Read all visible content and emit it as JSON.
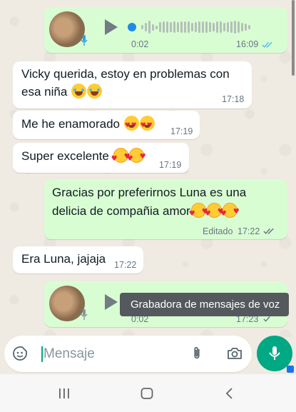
{
  "messages": [
    {
      "type": "voice",
      "direction": "out",
      "duration": "0:02",
      "time": "16:09",
      "status": "read"
    },
    {
      "type": "text",
      "direction": "in",
      "line1": "Vicky querida, estoy en problemas con",
      "line2": "esa niña",
      "emojis": [
        "rolling-laughing",
        "rolling-laughing"
      ],
      "time": "17:18"
    },
    {
      "type": "text",
      "direction": "in",
      "text": "Me he enamorado",
      "emojis": [
        "heart-eyes",
        "heart-eyes"
      ],
      "time": "17:19"
    },
    {
      "type": "text",
      "direction": "in",
      "text": "Super excelente",
      "emojis": [
        "smiling-hearts",
        "smiling-hearts"
      ],
      "time": "17:19"
    },
    {
      "type": "text",
      "direction": "out",
      "line1": "Gracias por preferirnos Luna es una",
      "line2": "delicia de compañia amor",
      "emojis": [
        "smiling-hearts",
        "smiling-hearts",
        "smiling-hearts"
      ],
      "edited_label": "Editado",
      "time": "17:22",
      "status": "read"
    },
    {
      "type": "text",
      "direction": "in",
      "text": "Era Luna, jajaja",
      "time": "17:22"
    },
    {
      "type": "voice",
      "direction": "out",
      "duration": "0:02",
      "time": "17:23",
      "status": "sent"
    }
  ],
  "tooltip": "Grabadora de mensajes de voz",
  "composer": {
    "placeholder": "Mensaje"
  },
  "colors": {
    "outgoing": "#d9fdd3",
    "incoming": "#ffffff",
    "accent": "#00a884",
    "read_ticks": "#53bdeb"
  },
  "icons": [
    "emoji-icon",
    "attach-icon",
    "camera-icon",
    "mic-icon",
    "play-icon",
    "recents-icon",
    "home-icon",
    "back-icon"
  ]
}
